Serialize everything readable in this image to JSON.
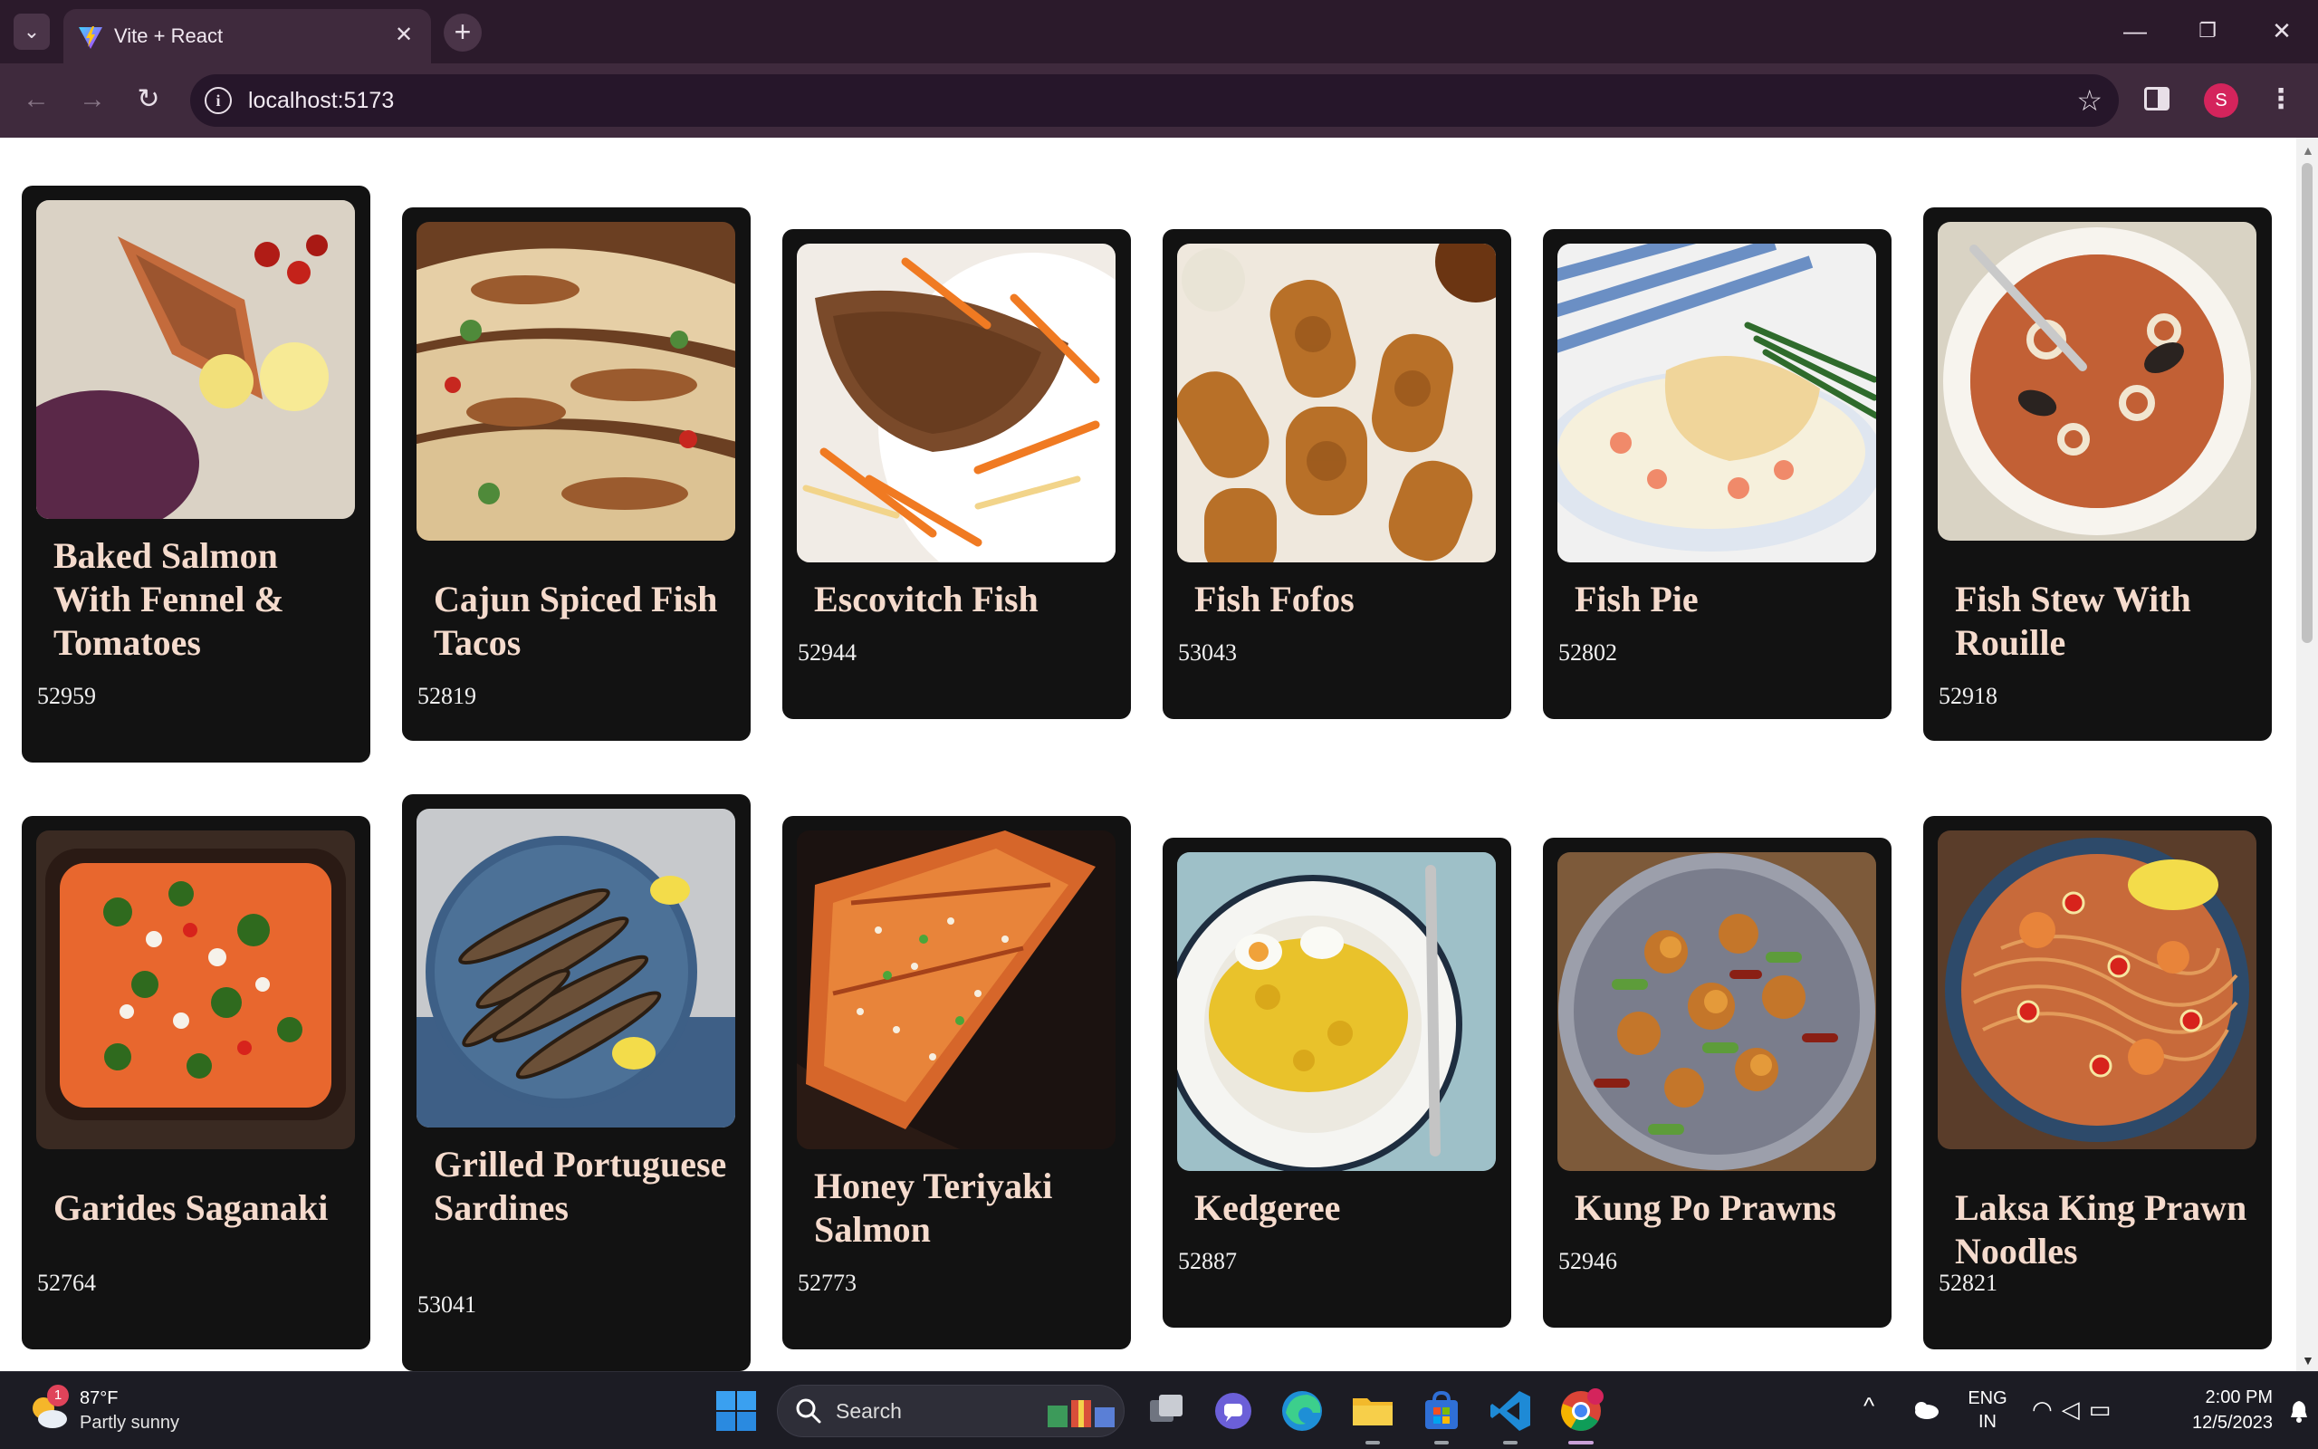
{
  "browser": {
    "tab_title": "Vite + React",
    "url": "localhost:5173",
    "profile_initial": "S",
    "tab_close_glyph": "✕",
    "new_tab_glyph": "+",
    "menu_glyph": "⋮"
  },
  "recipes": [
    {
      "title": "Baked Salmon With Fennel & Tomatoes",
      "id": "52959"
    },
    {
      "title": "Cajun Spiced Fish Tacos",
      "id": "52819"
    },
    {
      "title": "Escovitch Fish",
      "id": "52944"
    },
    {
      "title": "Fish Fofos",
      "id": "53043"
    },
    {
      "title": "Fish Pie",
      "id": "52802"
    },
    {
      "title": "Fish Stew With Rouille",
      "id": "52918"
    },
    {
      "title": "Garides Saganaki",
      "id": "52764"
    },
    {
      "title": "Grilled Portuguese Sardines",
      "id": "53041"
    },
    {
      "title": "Honey Teriyaki Salmon",
      "id": "52773"
    },
    {
      "title": "Kedgeree",
      "id": "52887"
    },
    {
      "title": "Kung Po Prawns",
      "id": "52946"
    },
    {
      "title": "Laksa King Prawn Noodles",
      "id": "52821"
    }
  ],
  "taskbar": {
    "weather_temp": "87°F",
    "weather_desc": "Partly sunny",
    "weather_badge": "1",
    "search_label": "Search",
    "lang_line1": "ENG",
    "lang_line2": "IN",
    "time": "2:00 PM",
    "date": "12/5/2023"
  },
  "colors": {
    "card_bg": "#121212",
    "card_title": "#f5dbcd",
    "chrome_dark": "#2b1a2b",
    "chrome_toolbar": "#3f2a3d"
  }
}
